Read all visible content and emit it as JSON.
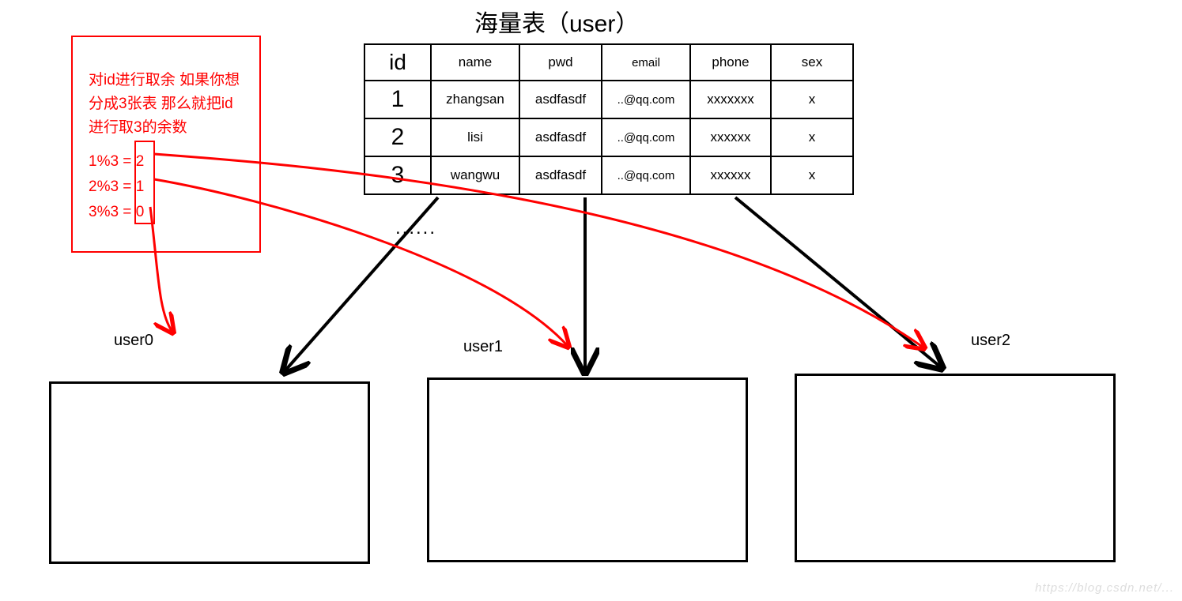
{
  "title": "海量表（user）",
  "table": {
    "headers": [
      "id",
      "name",
      "pwd",
      "email",
      "phone",
      "sex"
    ],
    "rows": [
      {
        "id": "1",
        "name": "zhangsan",
        "pwd": "asdfasdf",
        "email": "..@qq.com",
        "phone": "xxxxxxx",
        "sex": "x"
      },
      {
        "id": "2",
        "name": "lisi",
        "pwd": "asdfasdf",
        "email": "..@qq.com",
        "phone": "xxxxxx",
        "sex": "x"
      },
      {
        "id": "3",
        "name": "wangwu",
        "pwd": "asdfasdf",
        "email": "..@qq.com",
        "phone": "xxxxxx",
        "sex": "x"
      }
    ],
    "ellipsis": "......"
  },
  "annotation": {
    "line1": "对id进行取余 如果你想",
    "line2": "分成3张表 那么就把id",
    "line3": "进行取3的余数",
    "mods": [
      {
        "expr": "1%3 =",
        "res": "2"
      },
      {
        "expr": "2%3 =",
        "res": "1"
      },
      {
        "expr": "3%3 =",
        "res": "0"
      }
    ]
  },
  "sub_tables": {
    "user0": "user0",
    "user1": "user1",
    "user2": "user2"
  },
  "colors": {
    "black": "#000000",
    "red": "#ff0000"
  },
  "watermark": "https://blog.csdn.net/..."
}
